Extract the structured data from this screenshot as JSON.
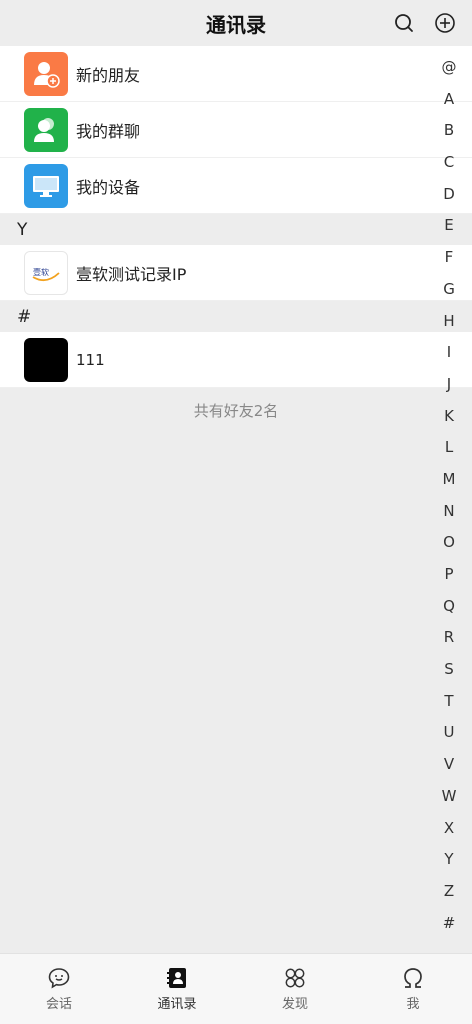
{
  "header": {
    "title": "通讯录"
  },
  "top_items": [
    {
      "label": "新的朋友",
      "icon": "add-friend-icon",
      "color": "#fa7a45"
    },
    {
      "label": "我的群聊",
      "icon": "group-chat-icon",
      "color": "#21b24a"
    },
    {
      "label": "我的设备",
      "icon": "device-monitor-icon",
      "color": "#2e9be6"
    }
  ],
  "sections": [
    {
      "letter": "Y",
      "contacts": [
        {
          "name": "壹软测试记录IP",
          "avatar_text": "壹软"
        }
      ]
    },
    {
      "letter": "#",
      "contacts": [
        {
          "name": "111"
        }
      ]
    }
  ],
  "footer": {
    "count_text": "共有好友2名"
  },
  "index_letters": [
    "@",
    "A",
    "B",
    "C",
    "D",
    "E",
    "F",
    "G",
    "H",
    "I",
    "J",
    "K",
    "L",
    "M",
    "N",
    "O",
    "P",
    "Q",
    "R",
    "S",
    "T",
    "U",
    "V",
    "W",
    "X",
    "Y",
    "Z",
    "#"
  ],
  "tabs": [
    {
      "label": "会话",
      "icon": "chat-bubble-icon",
      "active": false
    },
    {
      "label": "通讯录",
      "icon": "contacts-book-icon",
      "active": true
    },
    {
      "label": "发现",
      "icon": "discover-clover-icon",
      "active": false
    },
    {
      "label": "我",
      "icon": "me-omega-icon",
      "active": false
    }
  ]
}
